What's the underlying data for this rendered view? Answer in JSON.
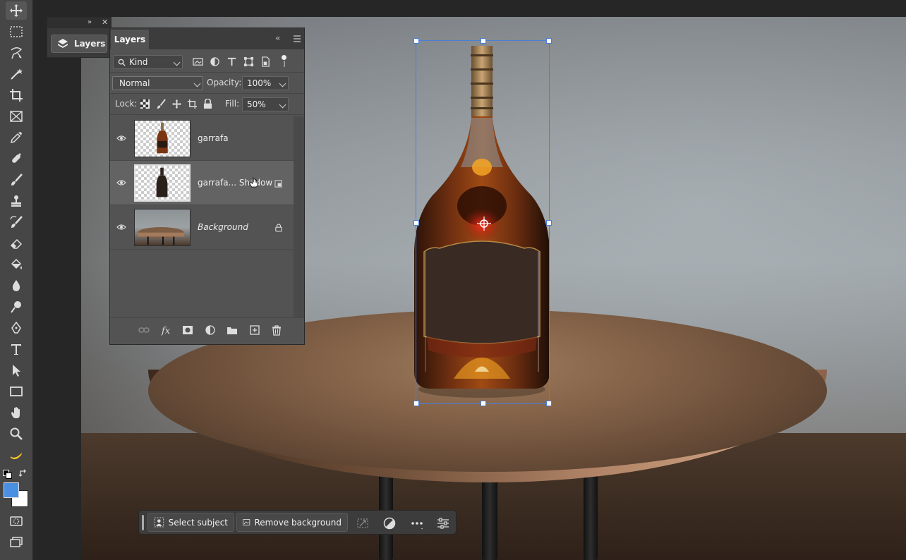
{
  "app": {
    "collapsed_panel_label": "Layers",
    "accent_color": "#4a7fd8"
  },
  "tools": [
    {
      "name": "move-tool-icon"
    },
    {
      "name": "rectangular-marquee-icon"
    },
    {
      "name": "lasso-icon"
    },
    {
      "name": "magic-wand-icon"
    },
    {
      "name": "crop-icon"
    },
    {
      "name": "frame-icon"
    },
    {
      "name": "eyedropper-icon"
    },
    {
      "name": "spot-healing-icon"
    },
    {
      "name": "brush-icon"
    },
    {
      "name": "clone-stamp-icon"
    },
    {
      "name": "history-brush-icon"
    },
    {
      "name": "eraser-icon"
    },
    {
      "name": "paint-bucket-icon"
    },
    {
      "name": "blur-icon"
    },
    {
      "name": "dodge-icon"
    },
    {
      "name": "pen-icon"
    },
    {
      "name": "type-icon"
    },
    {
      "name": "path-selection-icon"
    },
    {
      "name": "rectangle-icon"
    },
    {
      "name": "hand-icon"
    },
    {
      "name": "zoom-icon"
    },
    {
      "name": "banana-icon"
    }
  ],
  "toolbar": {
    "foreground_color": "#4a90e2",
    "background_color": "#ffffff"
  },
  "layers_panel": {
    "tab_label": "Layers",
    "filter": {
      "label": "Kind"
    },
    "blend_mode": "Normal",
    "opacity_label": "Opacity:",
    "opacity_value": "100%",
    "lock_label": "Lock:",
    "fill_label": "Fill:",
    "fill_value": "50%",
    "layers": [
      {
        "name": "garrafa",
        "visible": true,
        "selected": false,
        "italic": false
      },
      {
        "name": "garrafa... Shadow",
        "visible": true,
        "selected": true,
        "italic": false
      },
      {
        "name": "Background",
        "visible": true,
        "selected": false,
        "italic": true,
        "locked": true
      }
    ]
  },
  "taskbar": {
    "select_subject": "Select subject",
    "remove_background": "Remove background"
  }
}
